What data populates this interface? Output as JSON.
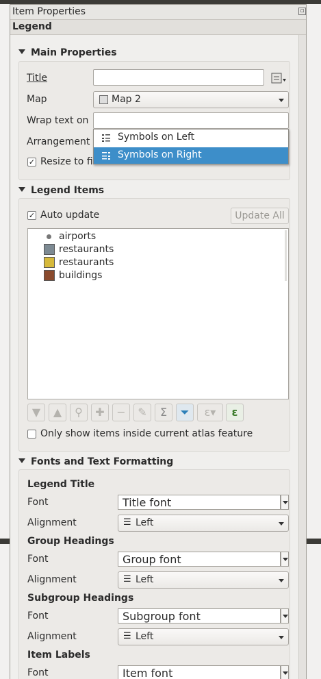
{
  "window": {
    "title": "Item Properties",
    "subtitle": "Legend"
  },
  "main_properties": {
    "heading": "Main Properties",
    "title_label": "Title",
    "title_value": "",
    "map_label": "Map",
    "map_value": "Map 2",
    "wrap_label": "Wrap text on",
    "wrap_value": "",
    "arrangement_label": "Arrangement",
    "resize_label": "Resize to fit contents",
    "resize_checked": true,
    "arrangement_options": [
      "Symbols on Left",
      "Symbols on Right"
    ],
    "arrangement_selected": "Symbols on Right"
  },
  "legend_items": {
    "heading": "Legend Items",
    "auto_update_label": "Auto update",
    "auto_update_checked": true,
    "update_all_label": "Update All",
    "items": [
      {
        "label": "airports",
        "icon": "point",
        "color": "#777777"
      },
      {
        "label": "restaurants",
        "icon": "fill",
        "color": "#7d8a93"
      },
      {
        "label": "restaurants",
        "icon": "fill",
        "color": "#d6b93b"
      },
      {
        "label": "buildings",
        "icon": "fill",
        "color": "#8a4a2d"
      }
    ],
    "toolbar": [
      "move-down-icon",
      "move-up-icon",
      "add-group-icon",
      "add-item-icon",
      "remove-item-icon",
      "edit-icon",
      "sum-icon",
      "filter-icon",
      "expression-filter-icon",
      "expression-icon"
    ],
    "atlas_label": "Only show items inside current atlas feature",
    "atlas_checked": false
  },
  "fonts": {
    "heading": "Fonts and Text Formatting",
    "font_label": "Font",
    "alignment_label": "Alignment",
    "sections": [
      {
        "title": "Legend Title",
        "font": "Title font",
        "alignment": "Left"
      },
      {
        "title": "Group Headings",
        "font": "Group font",
        "alignment": "Left"
      },
      {
        "title": "Subgroup Headings",
        "font": "Subgroup font",
        "alignment": "Left"
      },
      {
        "title": "Item Labels",
        "font": "Item font"
      }
    ]
  },
  "colors": {
    "selection": "#3d8ec9",
    "popup_bg": "#ffffff"
  }
}
